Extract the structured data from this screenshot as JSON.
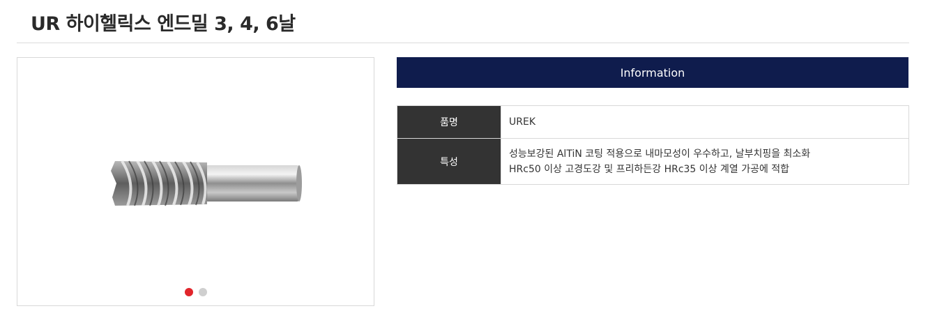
{
  "page": {
    "title": "UR 하이헬릭스 엔드밀 3, 4, 6날"
  },
  "gallery": {
    "image_subject": "end mill cutting tool",
    "slide_count": 2,
    "active_slide": 1,
    "dot_active_color": "#e1252b",
    "dot_inactive_color": "#cfcfcf"
  },
  "info": {
    "header": "Information",
    "header_color": "#0f1c4d",
    "rows": [
      {
        "label": "품명",
        "lines": [
          "UREK"
        ]
      },
      {
        "label": "특성",
        "lines": [
          "성능보강된 AlTiN 코팅 적용으로 내마모성이 우수하고, 날부치핑을 최소화",
          "HRc50 이상 고경도강 및 프리하든강 HRc35 이상 계열 가공에 적합"
        ]
      }
    ]
  }
}
